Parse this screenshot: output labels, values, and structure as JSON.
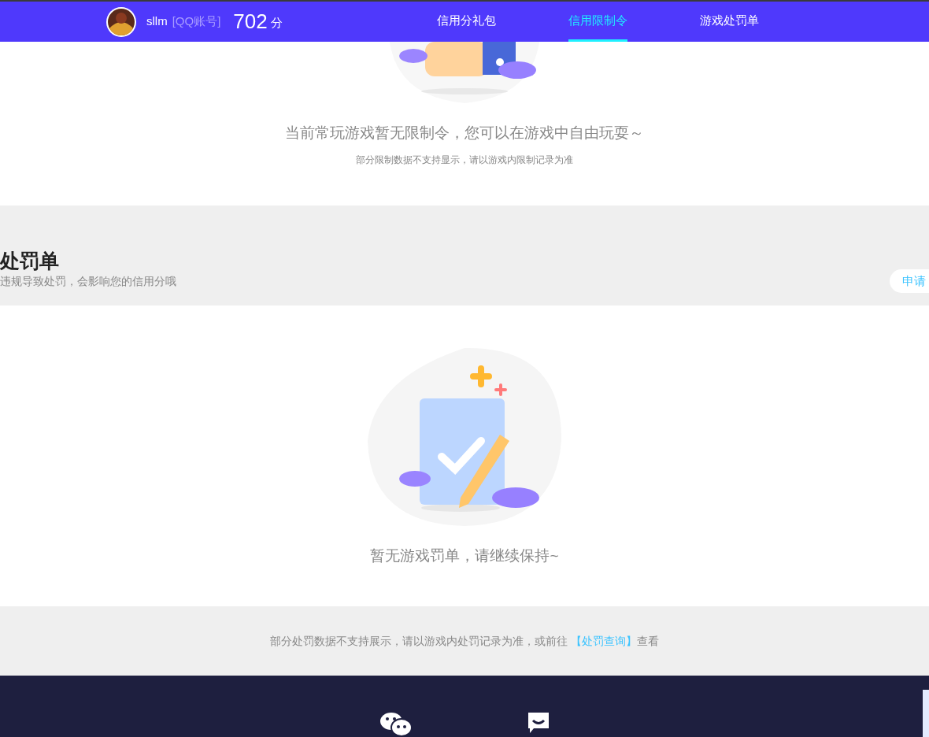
{
  "header": {
    "username": "sllm",
    "account_type": "[QQ账号]",
    "score": "702",
    "score_unit": "分",
    "tabs": [
      {
        "label": "信用分礼包",
        "selected": false
      },
      {
        "label": "信用限制令",
        "selected": true
      },
      {
        "label": "游戏处罚单",
        "selected": false
      }
    ]
  },
  "restriction": {
    "empty_message": "当前常玩游戏暂无限制令，您可以在游戏中自由玩耍～",
    "note": "部分限制数据不支持显示，请以游戏内限制记录为准"
  },
  "penalty": {
    "title": "处罚单",
    "subtitle": "违规导致处罚，会影响您的信用分哦",
    "apply_button": "申请",
    "empty_message": "暂无游戏罚单，请继续保持~",
    "note": "部分处罚数据不支持展示，请以游戏内处罚记录为准，或前往 ",
    "link": "【处罚查询】",
    "note_end": "查看"
  }
}
